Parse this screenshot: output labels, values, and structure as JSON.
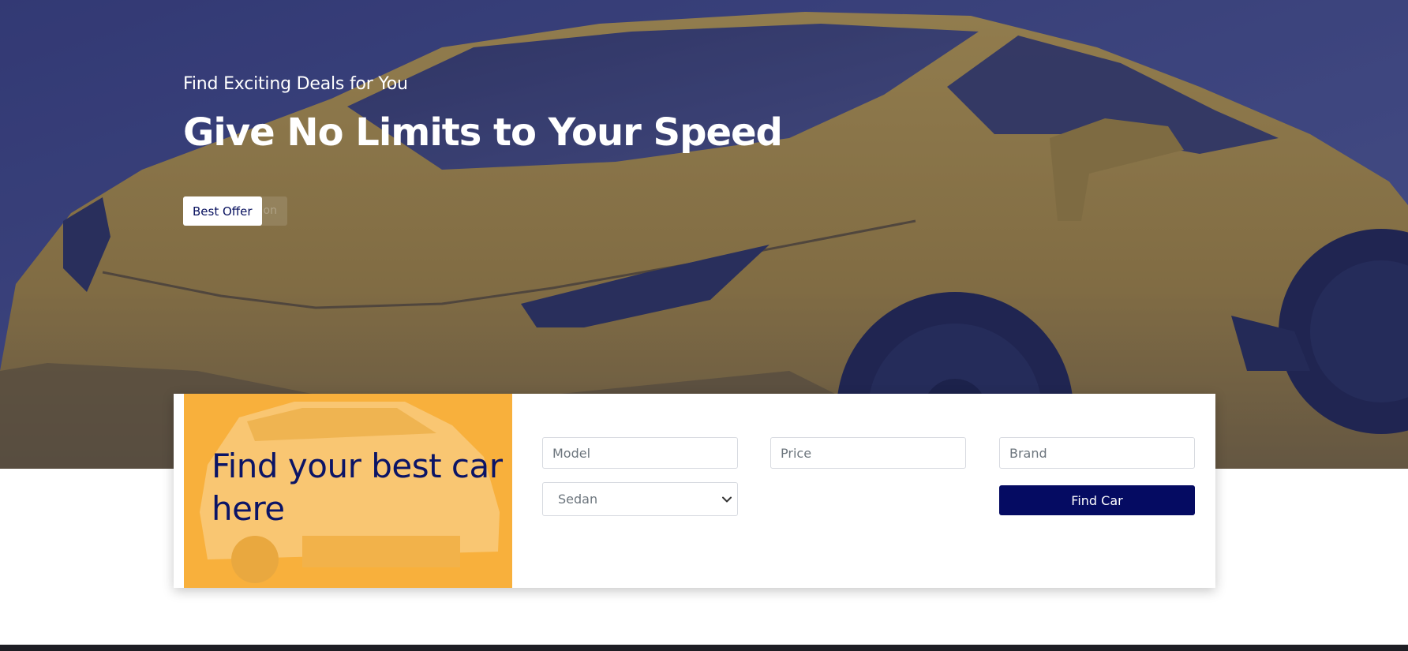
{
  "hero": {
    "subtitle": "Find Exciting Deals for You",
    "title": "Give No Limits to Your Speed",
    "primary_button": "Best Offer",
    "secondary_button": "on",
    "image": "yellow-sports-car",
    "colors": {
      "overlay": "#2a316e",
      "car": "#c9a22e"
    }
  },
  "search": {
    "promo_title": "Find your best car here",
    "promo_image": "silver-sedan",
    "promo_color": "#f8b03c",
    "model_placeholder": "Model",
    "price_placeholder": "Price",
    "brand_placeholder": "Brand",
    "type_selected": "Sedan",
    "find_button": "Find Car",
    "button_color": "#050b62"
  },
  "icons": {
    "select_arrow": "chevron-down-icon"
  }
}
